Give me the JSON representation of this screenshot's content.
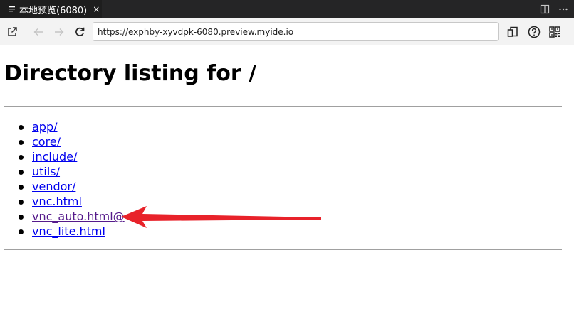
{
  "tab": {
    "title": "本地预览(6080)",
    "close": "×"
  },
  "tabbar_actions": [
    "split-editor-icon",
    "more-actions-icon"
  ],
  "toolbar": {
    "url": "https://exphby-xyvdpk-6080.preview.myide.io",
    "icons": [
      "open-external-icon",
      "back-icon",
      "forward-icon",
      "reload-icon",
      "devices-icon",
      "help-icon",
      "qr-code-icon"
    ]
  },
  "page": {
    "title": "Directory listing for /",
    "entries": [
      {
        "label": "app/",
        "visited": false
      },
      {
        "label": "core/",
        "visited": false
      },
      {
        "label": "include/",
        "visited": false
      },
      {
        "label": "utils/",
        "visited": false
      },
      {
        "label": "vendor/",
        "visited": false
      },
      {
        "label": "vnc.html",
        "visited": false
      },
      {
        "label": "vnc_auto.html@",
        "visited": true
      },
      {
        "label": "vnc_lite.html",
        "visited": false
      }
    ]
  },
  "annotation": {
    "arrow_color": "#e8222a"
  },
  "colors": {
    "tab_bg": "#1e1e1e",
    "tabbar_bg": "#252526",
    "toolbar_bg": "#f3f3f3",
    "link": "#0000ee",
    "visited_link": "#551a8b"
  }
}
